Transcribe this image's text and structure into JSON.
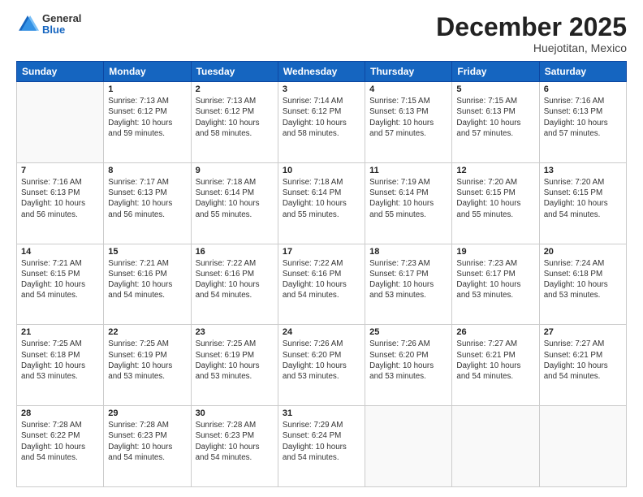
{
  "header": {
    "logo_general": "General",
    "logo_blue": "Blue",
    "month_title": "December 2025",
    "location": "Huejotitan, Mexico"
  },
  "weekdays": [
    "Sunday",
    "Monday",
    "Tuesday",
    "Wednesday",
    "Thursday",
    "Friday",
    "Saturday"
  ],
  "weeks": [
    [
      {
        "day": "",
        "sunrise": "",
        "sunset": "",
        "daylight": ""
      },
      {
        "day": "1",
        "sunrise": "7:13 AM",
        "sunset": "6:12 PM",
        "daylight": "10 hours and 59 minutes."
      },
      {
        "day": "2",
        "sunrise": "7:13 AM",
        "sunset": "6:12 PM",
        "daylight": "10 hours and 58 minutes."
      },
      {
        "day": "3",
        "sunrise": "7:14 AM",
        "sunset": "6:12 PM",
        "daylight": "10 hours and 58 minutes."
      },
      {
        "day": "4",
        "sunrise": "7:15 AM",
        "sunset": "6:13 PM",
        "daylight": "10 hours and 57 minutes."
      },
      {
        "day": "5",
        "sunrise": "7:15 AM",
        "sunset": "6:13 PM",
        "daylight": "10 hours and 57 minutes."
      },
      {
        "day": "6",
        "sunrise": "7:16 AM",
        "sunset": "6:13 PM",
        "daylight": "10 hours and 57 minutes."
      }
    ],
    [
      {
        "day": "7",
        "sunrise": "7:16 AM",
        "sunset": "6:13 PM",
        "daylight": "10 hours and 56 minutes."
      },
      {
        "day": "8",
        "sunrise": "7:17 AM",
        "sunset": "6:13 PM",
        "daylight": "10 hours and 56 minutes."
      },
      {
        "day": "9",
        "sunrise": "7:18 AM",
        "sunset": "6:14 PM",
        "daylight": "10 hours and 55 minutes."
      },
      {
        "day": "10",
        "sunrise": "7:18 AM",
        "sunset": "6:14 PM",
        "daylight": "10 hours and 55 minutes."
      },
      {
        "day": "11",
        "sunrise": "7:19 AM",
        "sunset": "6:14 PM",
        "daylight": "10 hours and 55 minutes."
      },
      {
        "day": "12",
        "sunrise": "7:20 AM",
        "sunset": "6:15 PM",
        "daylight": "10 hours and 55 minutes."
      },
      {
        "day": "13",
        "sunrise": "7:20 AM",
        "sunset": "6:15 PM",
        "daylight": "10 hours and 54 minutes."
      }
    ],
    [
      {
        "day": "14",
        "sunrise": "7:21 AM",
        "sunset": "6:15 PM",
        "daylight": "10 hours and 54 minutes."
      },
      {
        "day": "15",
        "sunrise": "7:21 AM",
        "sunset": "6:16 PM",
        "daylight": "10 hours and 54 minutes."
      },
      {
        "day": "16",
        "sunrise": "7:22 AM",
        "sunset": "6:16 PM",
        "daylight": "10 hours and 54 minutes."
      },
      {
        "day": "17",
        "sunrise": "7:22 AM",
        "sunset": "6:16 PM",
        "daylight": "10 hours and 54 minutes."
      },
      {
        "day": "18",
        "sunrise": "7:23 AM",
        "sunset": "6:17 PM",
        "daylight": "10 hours and 53 minutes."
      },
      {
        "day": "19",
        "sunrise": "7:23 AM",
        "sunset": "6:17 PM",
        "daylight": "10 hours and 53 minutes."
      },
      {
        "day": "20",
        "sunrise": "7:24 AM",
        "sunset": "6:18 PM",
        "daylight": "10 hours and 53 minutes."
      }
    ],
    [
      {
        "day": "21",
        "sunrise": "7:25 AM",
        "sunset": "6:18 PM",
        "daylight": "10 hours and 53 minutes."
      },
      {
        "day": "22",
        "sunrise": "7:25 AM",
        "sunset": "6:19 PM",
        "daylight": "10 hours and 53 minutes."
      },
      {
        "day": "23",
        "sunrise": "7:25 AM",
        "sunset": "6:19 PM",
        "daylight": "10 hours and 53 minutes."
      },
      {
        "day": "24",
        "sunrise": "7:26 AM",
        "sunset": "6:20 PM",
        "daylight": "10 hours and 53 minutes."
      },
      {
        "day": "25",
        "sunrise": "7:26 AM",
        "sunset": "6:20 PM",
        "daylight": "10 hours and 53 minutes."
      },
      {
        "day": "26",
        "sunrise": "7:27 AM",
        "sunset": "6:21 PM",
        "daylight": "10 hours and 54 minutes."
      },
      {
        "day": "27",
        "sunrise": "7:27 AM",
        "sunset": "6:21 PM",
        "daylight": "10 hours and 54 minutes."
      }
    ],
    [
      {
        "day": "28",
        "sunrise": "7:28 AM",
        "sunset": "6:22 PM",
        "daylight": "10 hours and 54 minutes."
      },
      {
        "day": "29",
        "sunrise": "7:28 AM",
        "sunset": "6:23 PM",
        "daylight": "10 hours and 54 minutes."
      },
      {
        "day": "30",
        "sunrise": "7:28 AM",
        "sunset": "6:23 PM",
        "daylight": "10 hours and 54 minutes."
      },
      {
        "day": "31",
        "sunrise": "7:29 AM",
        "sunset": "6:24 PM",
        "daylight": "10 hours and 54 minutes."
      },
      {
        "day": "",
        "sunrise": "",
        "sunset": "",
        "daylight": ""
      },
      {
        "day": "",
        "sunrise": "",
        "sunset": "",
        "daylight": ""
      },
      {
        "day": "",
        "sunrise": "",
        "sunset": "",
        "daylight": ""
      }
    ]
  ],
  "labels": {
    "sunrise_prefix": "Sunrise: ",
    "sunset_prefix": "Sunset: ",
    "daylight_prefix": "Daylight: "
  }
}
